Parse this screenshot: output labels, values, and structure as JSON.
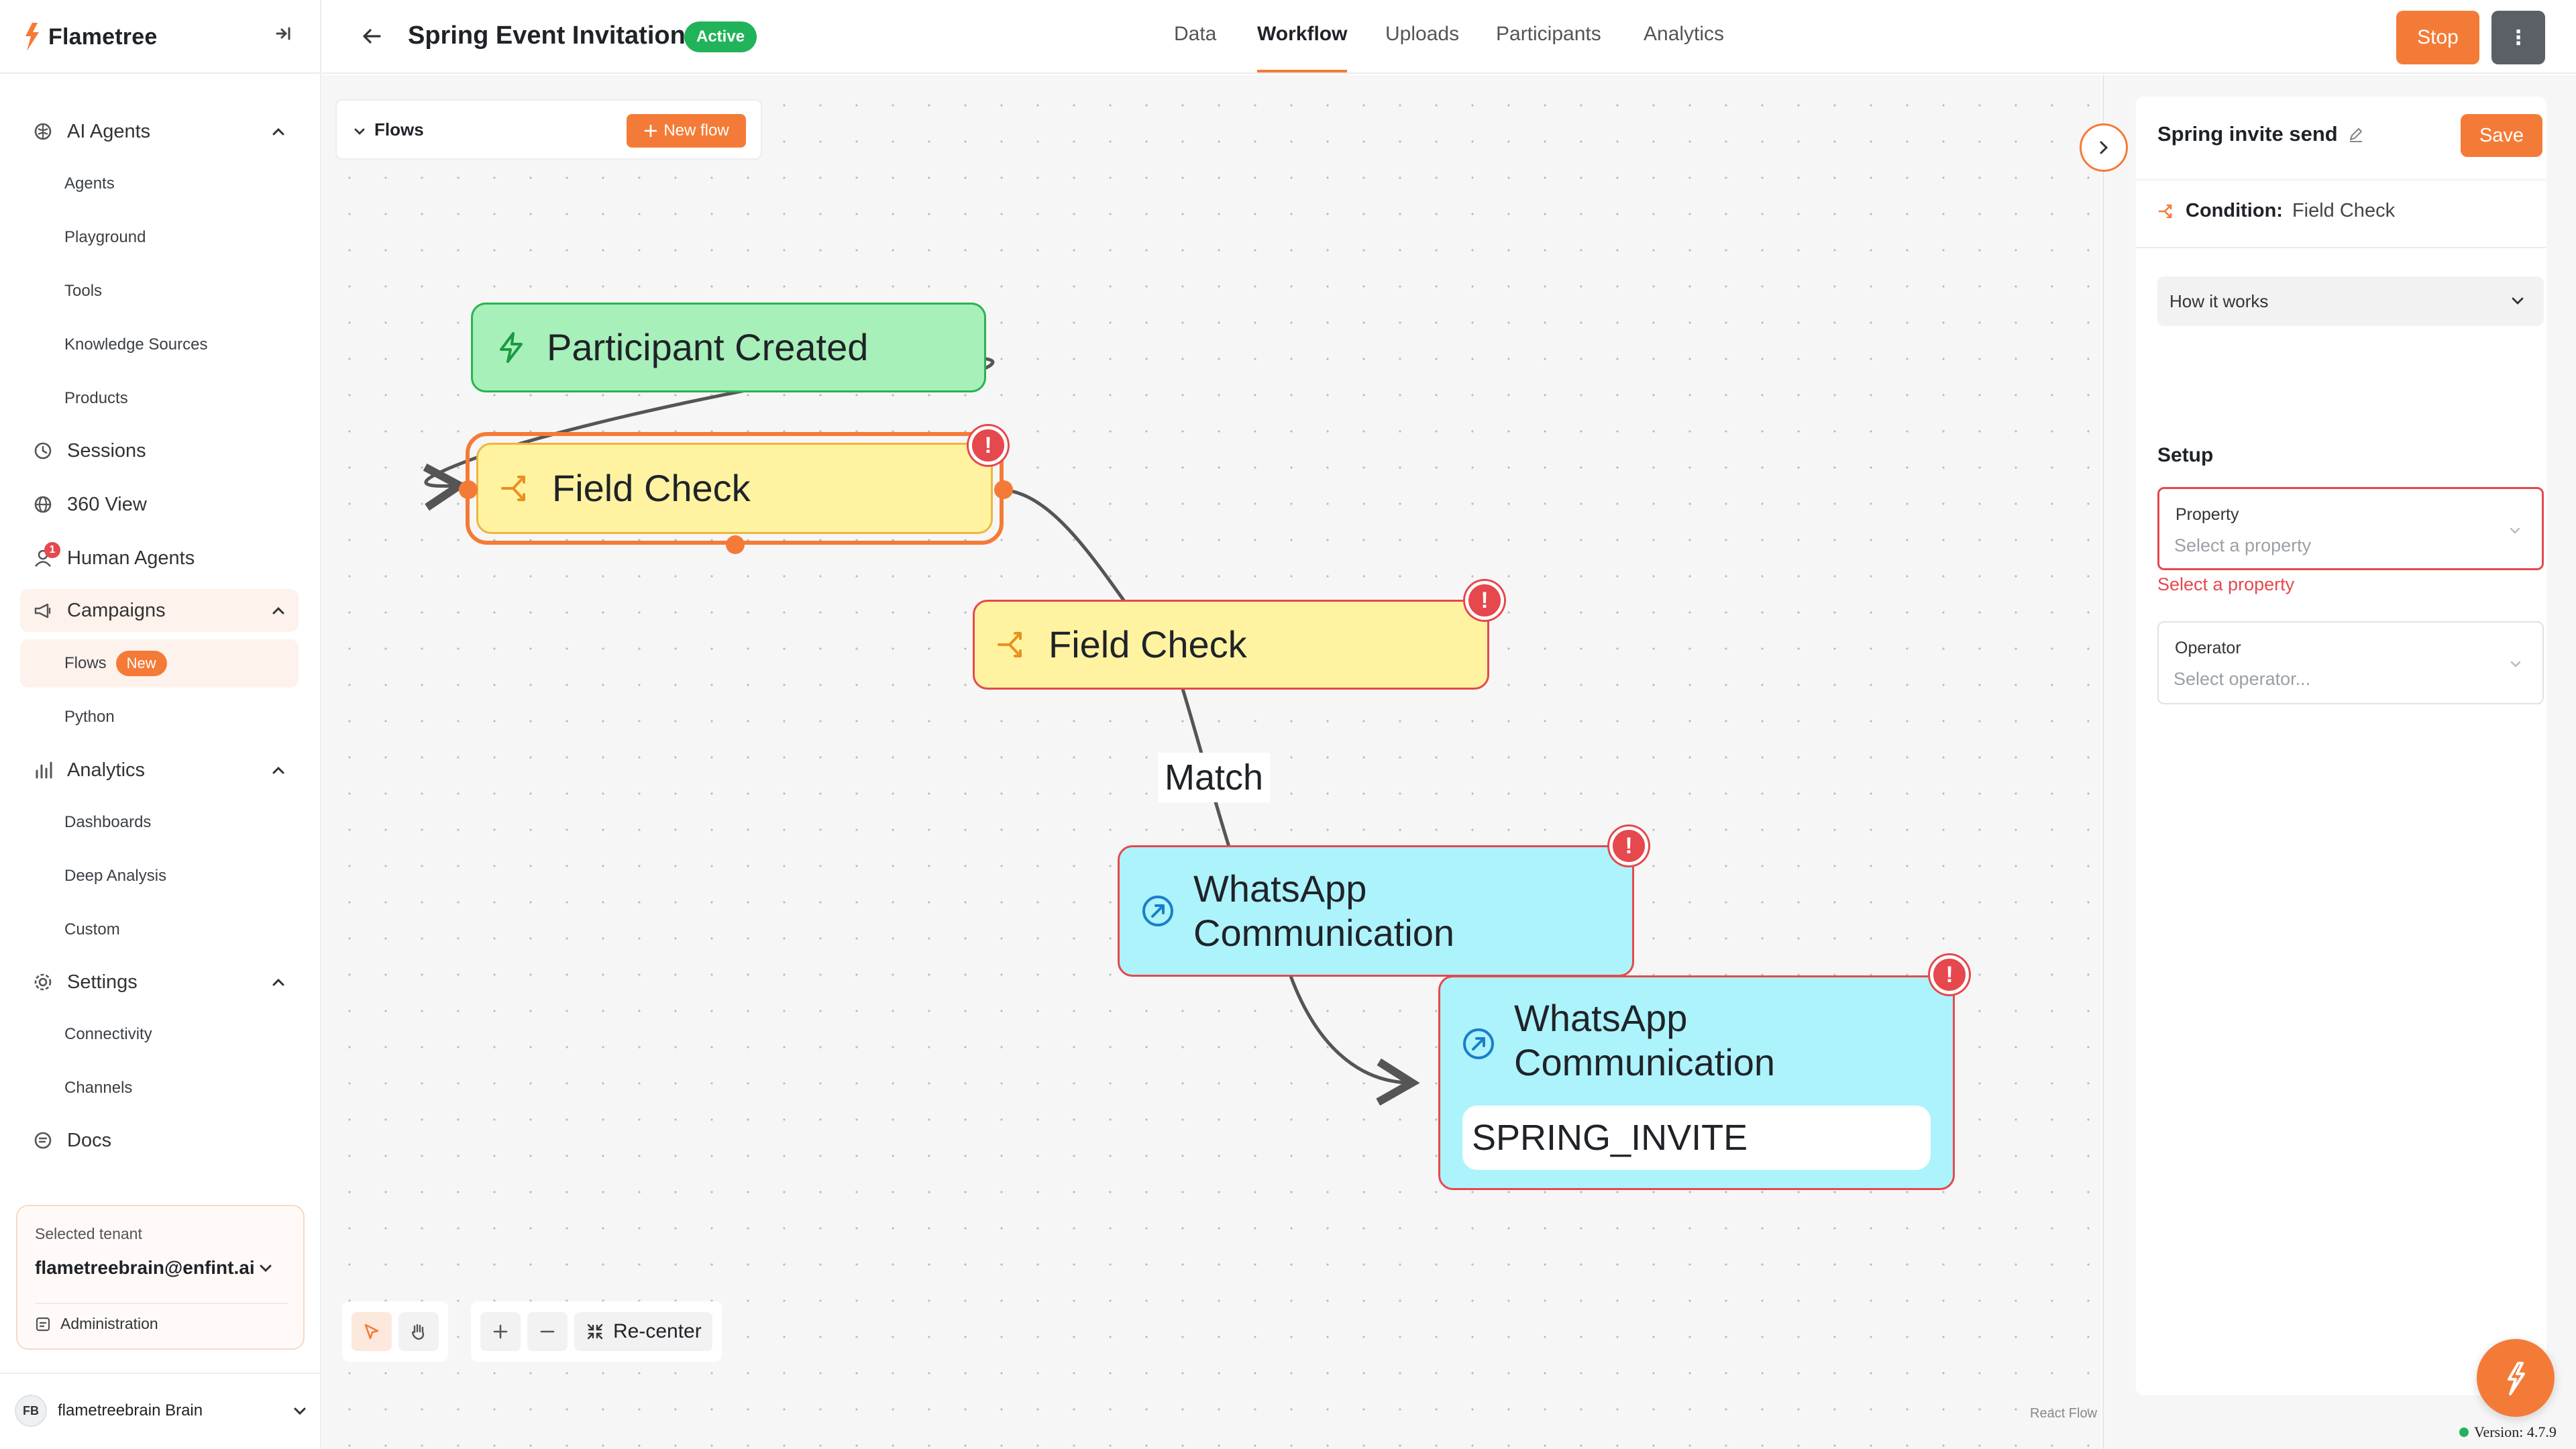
{
  "app": {
    "brand": "Flametree"
  },
  "colors": {
    "accent": "#f47b37",
    "success": "#21b35a",
    "error": "#e5484d",
    "trigger_node": "#a7f0b9",
    "condition_node": "#fff3a1",
    "action_node": "#adf3fb"
  },
  "sidebar": {
    "groups": [
      {
        "label": "AI Agents",
        "icon": "brain-icon",
        "items": [
          "Agents",
          "Playground",
          "Tools",
          "Knowledge Sources",
          "Products"
        ]
      },
      {
        "label": "Sessions",
        "icon": "sessions-icon"
      },
      {
        "label": "360 View",
        "icon": "globe-icon"
      },
      {
        "label": "Human Agents",
        "icon": "user-icon",
        "badge": "1"
      },
      {
        "label": "Campaigns",
        "icon": "megaphone-icon",
        "items": [
          "Flows",
          "Python"
        ],
        "active_item": "Flows",
        "new_badge": "New"
      },
      {
        "label": "Analytics",
        "icon": "chart-icon",
        "items": [
          "Dashboards",
          "Deep Analysis",
          "Custom"
        ]
      },
      {
        "label": "Settings",
        "icon": "gear-icon",
        "items": [
          "Connectivity",
          "Channels"
        ]
      },
      {
        "label": "Docs",
        "icon": "docs-icon"
      }
    ],
    "tenant": {
      "label": "Selected tenant",
      "email": "flametreebrain@enfint.ai",
      "admin_label": "Administration"
    },
    "user": {
      "initials": "FB",
      "name": "flametreebrain Brain"
    }
  },
  "header": {
    "title": "Spring Event Invitations",
    "status": "Active",
    "tabs": [
      "Data",
      "Workflow",
      "Uploads",
      "Participants",
      "Analytics"
    ],
    "active_tab": "Workflow",
    "stop_label": "Stop",
    "more_label": "⋮"
  },
  "canvas": {
    "flows_panel": {
      "title": "Flows",
      "new_flow_label": "New flow"
    },
    "nodes": [
      {
        "type": "trigger",
        "title": "Participant Created",
        "icon": "lightning-icon"
      },
      {
        "type": "condition",
        "title": "Field Check",
        "icon": "split-arrow-icon",
        "selected": true,
        "error": true
      },
      {
        "type": "condition",
        "title": "Field Check",
        "icon": "split-arrow-icon",
        "error": true
      },
      {
        "type": "action",
        "title": "WhatsApp Communication",
        "icon": "arrow-up-right-circle-icon",
        "error": true
      },
      {
        "type": "action",
        "title": "WhatsApp Communication",
        "icon": "arrow-up-right-circle-icon",
        "error": true,
        "template": "SPRING_INVITE"
      }
    ],
    "edge_label": "Match",
    "error_symbol": "!",
    "toolbar": {
      "recenter_label": "Re-center"
    },
    "attribution": "React Flow"
  },
  "right_panel": {
    "title": "Spring invite send",
    "save_label": "Save",
    "condition_label": "Condition:",
    "condition_value": "Field Check",
    "how_it_works": "How it works",
    "setup_label": "Setup",
    "property": {
      "label": "Property",
      "placeholder": "Select a property",
      "error": "Select a property"
    },
    "operator": {
      "label": "Operator",
      "placeholder": "Select operator..."
    }
  },
  "version": "Version: 4.7.9"
}
